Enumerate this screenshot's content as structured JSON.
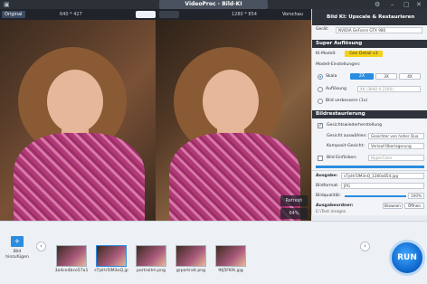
{
  "app": {
    "title": "VideoProc - Bild-KI"
  },
  "preview": {
    "original_label": "Original",
    "original_dims": "640 * 427",
    "output_dims": "1280 * 854",
    "preview_label": "Vorschau"
  },
  "overlay": {
    "refresh_label": "Refresh",
    "zoom": "64%"
  },
  "panel": {
    "header_title": "Bild KI: Upscale & Restaurieren",
    "device_label": "Gerät:",
    "device_value": "NVIDIA GeForce GTX 980",
    "sec_upscale": "Super Auflösung",
    "model_label": "KI-Modell:",
    "model_value": "Gen Detail v3",
    "settings_label": "Modell-Einstellungen:",
    "scale_label": "Skala",
    "scale_options": [
      "2X",
      "3X",
      "4X"
    ],
    "resolution_label": "Auflösung",
    "resolution_value": "4K (3840 X 2160)",
    "improve_label": "Bild verbessern (1x)",
    "sec_restore": "Bildrestaurierung",
    "face_label": "Gesichtswiederherstellung",
    "face_select_label": "Gesicht auswählen:",
    "face_select_value": "Gesichter von hoher Qua",
    "composite_label": "Komposit-Gesicht:",
    "composite_value": "Verlauf-Überlagerung",
    "colorize_label": "Bild Einfärben:",
    "colorize_value": "HyperColor",
    "output_label": "Ausgabe:",
    "output_value": "sTjsHr5lM3nQ_1280x854.jpg",
    "format_label": "Bildformat:",
    "format_value": "JPG",
    "quality_label": "Bildqualität:",
    "quality_value": "100%",
    "quality_fraction": 1.0,
    "folder_label": "Ausgabeordner:",
    "folder_value": "E:\\Test images",
    "browse_label": "Browsen",
    "open_label": "Öffnen"
  },
  "bottom": {
    "add_label": "Bild hinzufügen",
    "thumbs": [
      "3a4ce4bce57a1",
      "sTjsHr5lM3nQ.jp",
      "portraitm.png",
      "grportrait.png",
      "9tJ5FK9i.jpg"
    ],
    "run_label": "RUN"
  }
}
